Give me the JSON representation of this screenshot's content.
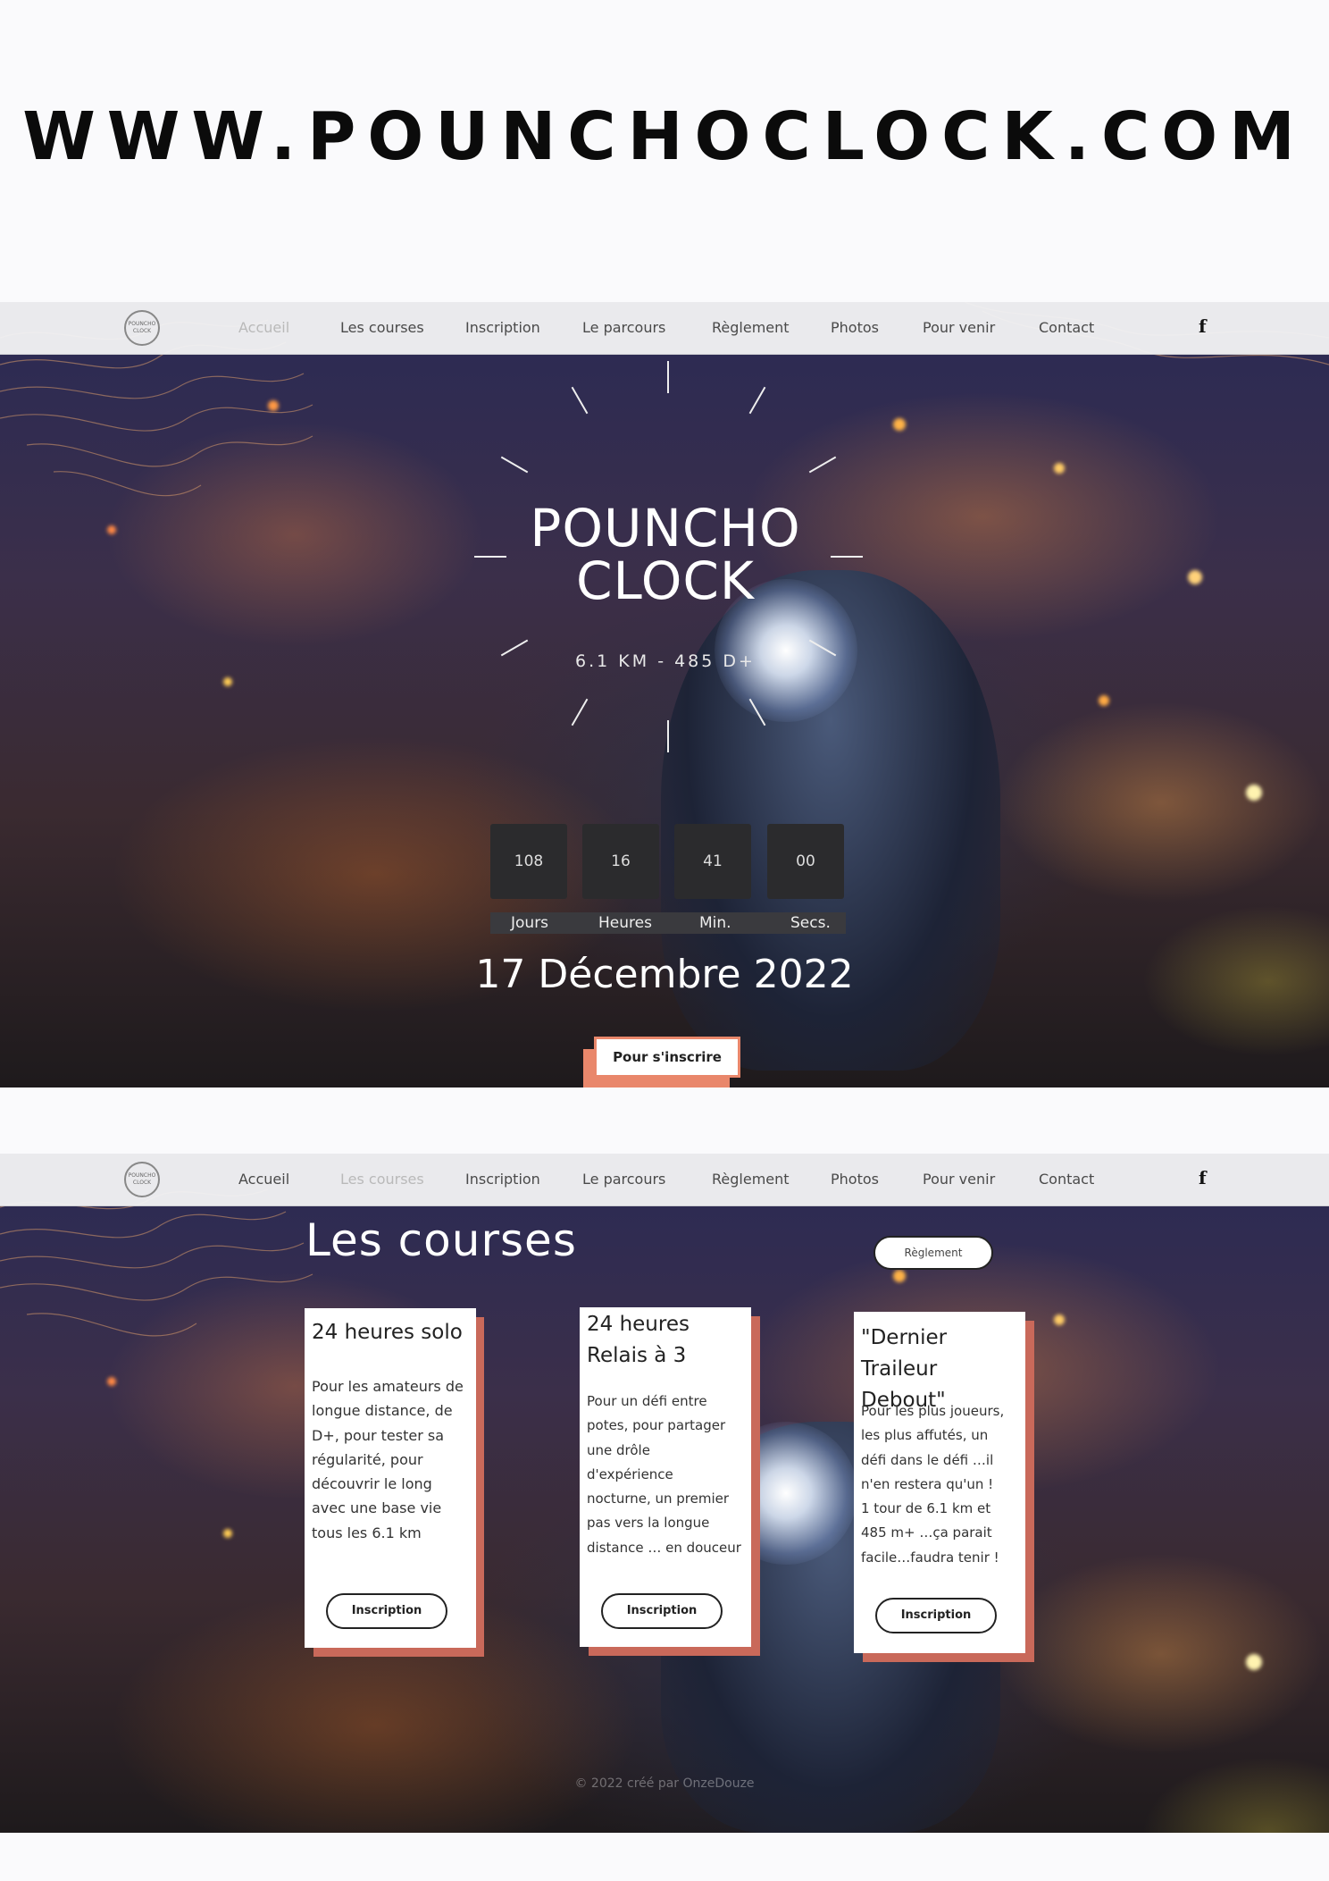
{
  "site_url": "WWW.POUNCHOCLOCK.COM",
  "nav": {
    "logo_text": "POUNCHO CLOCK",
    "items": [
      "Accueil",
      "Les courses",
      "Inscription",
      "Le parcours",
      "Règlement",
      "Photos",
      "Pour venir",
      "Contact"
    ],
    "facebook_icon": "f"
  },
  "hero": {
    "title_line1": "POUNCHO",
    "title_line2": "CLOCK",
    "subtitle": "6.1 KM - 485 D+",
    "countdown": {
      "values": [
        "108",
        "16",
        "41",
        "00"
      ],
      "labels": [
        "Jours",
        "Heures",
        "Min.",
        "Secs."
      ]
    },
    "date": "17 Décembre 2022",
    "cta_label": "Pour s'inscrire"
  },
  "courses": {
    "title": "Les courses",
    "reglement_label": "Règlement",
    "cards": [
      {
        "title": "24 heures solo",
        "text": "Pour les amateurs de\nlongue distance, de\nD+, pour tester sa\nrégularité, pour\ndécouvrir le long\navec une base vie\ntous les 6.1 km",
        "button": "Inscription"
      },
      {
        "title": "24 heures\nRelais à 3",
        "text": "Pour un défi entre\npotes, pour partager\nune drôle\nd'expérience\nnocturne, un premier\npas vers la longue\ndistance … en douceur",
        "button": "Inscription"
      },
      {
        "title": "\"Dernier Traileur\nDebout\"",
        "text": "Pour les plus joueurs,\nles plus affutés, un\ndéfi dans le défi …il\nn'en restera qu'un !\n1 tour de 6.1 km et\n485 m+ …ça parait\nfacile…faudra tenir !",
        "button": "Inscription"
      }
    ],
    "footer_credit": "© 2022 créé par OnzeDouze"
  },
  "colors": {
    "accent": "#e9876b",
    "card_shadow": "#c9695a",
    "nav_bg": "#f2f2f4"
  }
}
